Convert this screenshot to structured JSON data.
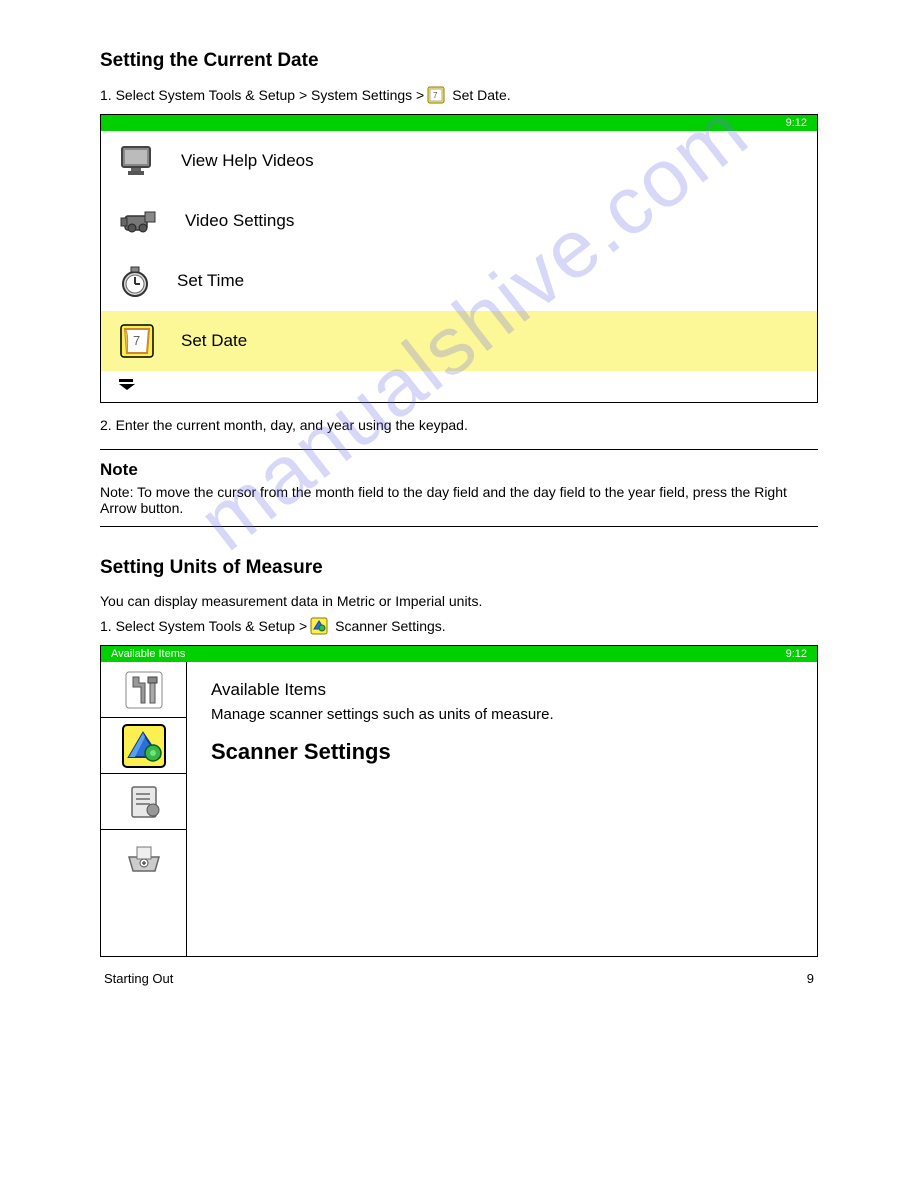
{
  "watermark": "manualshive.com",
  "section1": {
    "title": "Setting the Current Date",
    "step1_pre": "1.  Select System Tools & Setup > System Settings >",
    "step1_post": "Set Date.",
    "panel_head_right": "9:12",
    "rows": [
      {
        "label": "View Help Videos"
      },
      {
        "label": "Video Settings"
      },
      {
        "label": "Set Time"
      },
      {
        "label": "Set Date"
      }
    ],
    "step2": "2.  Enter the current month, day, and year using the keypad."
  },
  "note": {
    "head": "Note",
    "body": "Note: To move the cursor from the month field to the day field and the day field to the year field, press the Right Arrow button."
  },
  "section2": {
    "title": "Setting Units of Measure",
    "intro": "You can display measurement data in Metric or Imperial units.",
    "step1_pre": "1.  Select System Tools & Setup >",
    "step1_post": "Scanner Settings.",
    "panel_head_left": "Available Items",
    "panel_head_right": "9:12",
    "content_label": "Available Items",
    "content_desc": "Manage scanner settings such as units of measure.",
    "content_action": "Scanner Settings"
  },
  "footer": {
    "left": "Starting Out",
    "right": "9"
  }
}
